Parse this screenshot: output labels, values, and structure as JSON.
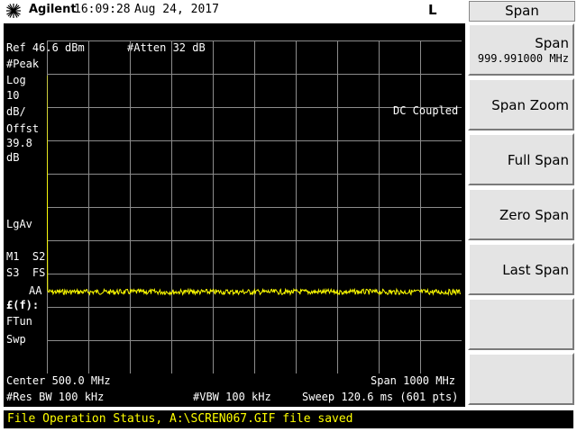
{
  "header": {
    "brand": "Agilent",
    "time": "16:09:28",
    "date": "Aug 24, 2017",
    "mode_letter": "L",
    "logo_icon": "agilent-spark-icon"
  },
  "screen": {
    "ref_level": "Ref 46.6 dBm",
    "atten": "#Atten 32 dB",
    "left_annotations": [
      "#Peak",
      "Log",
      "10",
      "dB/",
      "Offst",
      "39.8",
      "dB",
      "LgAv",
      "M1  S2",
      "S3  FS",
      "AA",
      "£(f):",
      "FTun",
      "Swp"
    ],
    "dc_coupled": "DC Coupled",
    "center": "Center 500.0 MHz",
    "span": "Span 1000 MHz",
    "res_bw": "#Res BW 100 kHz",
    "vbw": "#VBW 100 kHz",
    "sweep": "Sweep 120.6 ms (601 pts)"
  },
  "trace": {
    "color": "#ffff00",
    "points": 601,
    "noise_floor_div_from_top": 7.55,
    "start_div_from_top": 1.05
  },
  "status": {
    "message": "File Operation Status, A:\\SCREN067.GIF file saved"
  },
  "softkeys": {
    "title": "Span",
    "span": {
      "label": "Span",
      "value": "999.991000 MHz"
    },
    "span_zoom": "Span Zoom",
    "full_span": "Full Span",
    "zero_span": "Zero Span",
    "last_span": "Last Span"
  }
}
